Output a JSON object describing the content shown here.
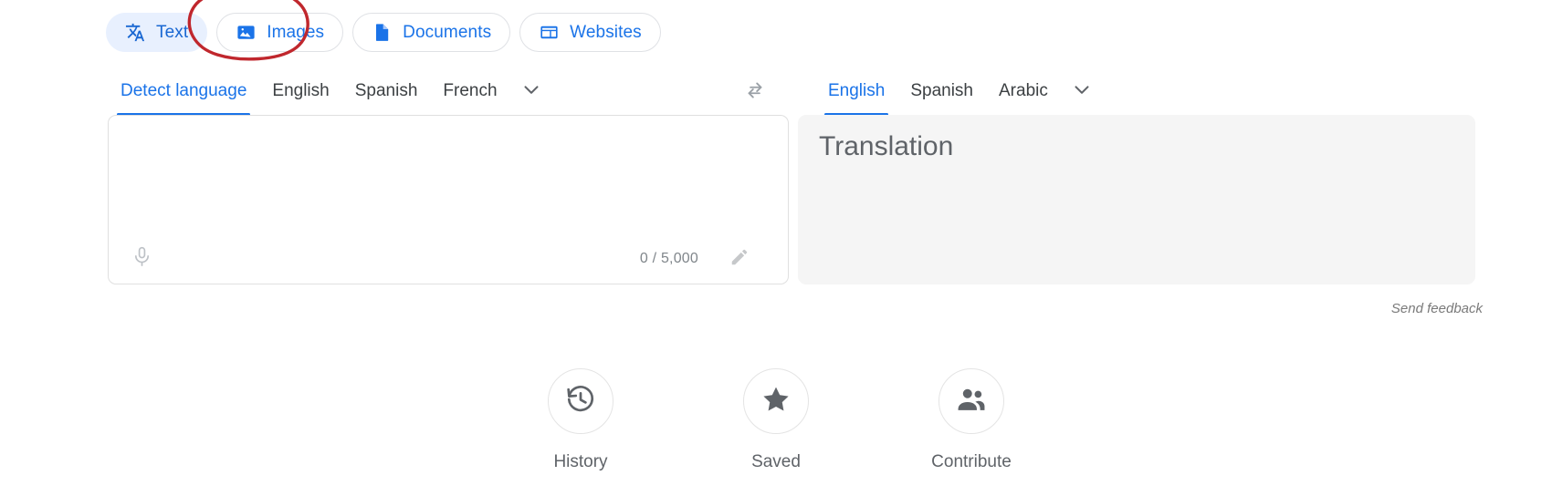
{
  "modes": {
    "tabs": [
      {
        "label": "Text",
        "icon": "translate-icon",
        "active": true,
        "name": "tab-text"
      },
      {
        "label": "Images",
        "icon": "image-icon",
        "active": false,
        "name": "tab-images"
      },
      {
        "label": "Documents",
        "icon": "document-icon",
        "active": false,
        "name": "tab-documents"
      },
      {
        "label": "Websites",
        "icon": "website-icon",
        "active": false,
        "name": "tab-websites"
      }
    ]
  },
  "annotation": {
    "shape": "hand-drawn-ellipse",
    "color": "#c0272d",
    "target": "Images"
  },
  "source": {
    "languages": [
      {
        "label": "Detect language",
        "active": true
      },
      {
        "label": "English",
        "active": false
      },
      {
        "label": "Spanish",
        "active": false
      },
      {
        "label": "French",
        "active": false
      }
    ],
    "more_icon": "chevron-down-icon",
    "text_value": "",
    "char_count": "0 / 5,000",
    "mic_icon": "microphone-icon",
    "handwrite_icon": "pencil-icon"
  },
  "swap": {
    "icon": "swap-horizontal-icon"
  },
  "target": {
    "languages": [
      {
        "label": "English",
        "active": true
      },
      {
        "label": "Spanish",
        "active": false
      },
      {
        "label": "Arabic",
        "active": false
      }
    ],
    "more_icon": "chevron-down-icon",
    "placeholder": "Translation"
  },
  "footer": {
    "send_feedback": "Send feedback"
  },
  "actions": [
    {
      "label": "History",
      "icon": "history-icon"
    },
    {
      "label": "Saved",
      "icon": "star-icon"
    },
    {
      "label": "Contribute",
      "icon": "people-icon"
    }
  ],
  "colors": {
    "accent_blue": "#1a73e8",
    "active_tab_bg": "#e8f0fe",
    "target_panel_bg": "#f5f5f5",
    "annotation_red": "#c0272d",
    "muted_text": "#5f6368"
  }
}
